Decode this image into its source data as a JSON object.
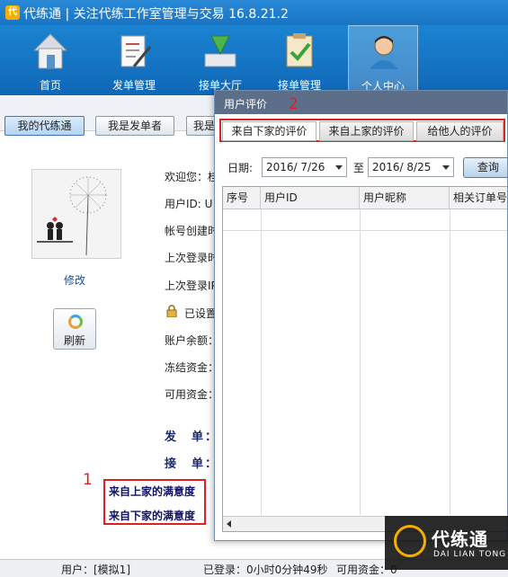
{
  "app": {
    "logo_text": "代",
    "title": "代练通 | 关注代练工作室管理与交易 16.8.21.2"
  },
  "nav": {
    "items": [
      {
        "label": "首页",
        "icon": "house-icon"
      },
      {
        "label": "发单管理",
        "icon": "clipboard-pen-icon"
      },
      {
        "label": "接单大厅",
        "icon": "download-arrow-icon"
      },
      {
        "label": "接单管理",
        "icon": "clipboard-check-icon"
      },
      {
        "label": "个人中心",
        "icon": "user-avatar-icon",
        "active": true
      }
    ]
  },
  "subnav": {
    "my_orders": "我的代练通",
    "im_sender": "我是发单者",
    "im_receiver": "我是"
  },
  "profile": {
    "edit": "修改",
    "refresh": "刷新",
    "welcome": "欢迎您：桂",
    "user_id": "用户ID: U",
    "created": "帐号创建时",
    "last_login_time": "上次登录时",
    "last_login_ip": "上次登录IP",
    "security": "已设置",
    "balance": "账户余额：",
    "frozen": "冻结资金：",
    "available": "可用资金：",
    "send_label": "发　单：",
    "receive_label": "接　单：",
    "satisfaction_from_upstream": "来自上家的满意度",
    "satisfaction_from_downstream": "来自下家的满意度"
  },
  "annotations": {
    "one": "1",
    "two": "2"
  },
  "dialog": {
    "title": "用户评价",
    "tabs": [
      {
        "label": "来自下家的评价",
        "active": true
      },
      {
        "label": "来自上家的评价"
      },
      {
        "label": "给他人的评价"
      }
    ],
    "date_label": "日期:",
    "date_from": "2016/ 7/26",
    "to_label": "至",
    "date_to": "2016/ 8/25",
    "query": "查询",
    "columns": [
      "序号",
      "用户ID",
      "用户昵称",
      "相关订单号"
    ]
  },
  "status": {
    "user": "用户：[模拟1]",
    "logged_in": "已登录：0小时0分钟49秒",
    "available": "可用资金：0"
  },
  "watermark": {
    "main": "代练通",
    "sub": "DAI LIAN TONG"
  },
  "colors": {
    "title_bar": "#1974c3",
    "nav_bar": "#0f67b6",
    "annotation_red": "#e02020",
    "dialog_title": "#5d6f88"
  }
}
